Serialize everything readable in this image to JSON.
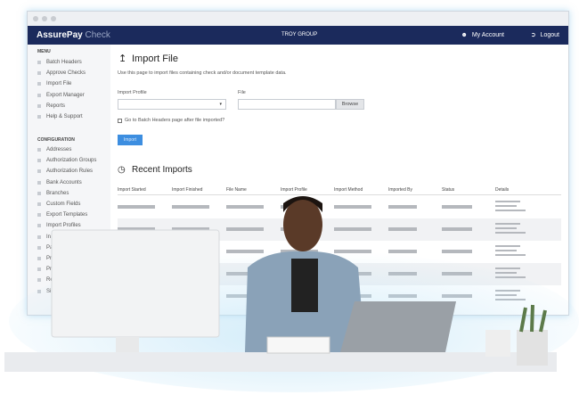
{
  "header": {
    "brand_bold": "AssurePay",
    "brand_light": " Check",
    "organization": "TROY GROUP",
    "my_account": "My Account",
    "logout": "Logout"
  },
  "sidebar": {
    "menu_heading": "MENU",
    "menu": [
      "Batch Headers",
      "Approve Checks",
      "Import File",
      "Export Manager",
      "Reports",
      "Help & Support"
    ],
    "config_heading": "CONFIGURATION",
    "config": [
      "Addresses",
      "Authorization Groups",
      "Authorization Rules",
      "Bank Accounts",
      "Branches",
      "Custom Fields",
      "Export Templates",
      "Import Profiles",
      "In",
      "Pay",
      "Print",
      "Printe",
      "Resou",
      "Signatu"
    ]
  },
  "main": {
    "title": "Import File",
    "description": "Use this page to import files containing check and/or document template data.",
    "import_profile_label": "Import Profile",
    "import_profile_value": "",
    "file_label": "File",
    "file_value": "",
    "browse": "Browse",
    "checkbox_label": "Go to Batch Headers page after file imported?",
    "checkbox_checked": false,
    "import_button": "Import",
    "recent_title": "Recent Imports",
    "columns": [
      "Import Started",
      "Import Finished",
      "File Name",
      "Import Profile",
      "Import Method",
      "Imported By",
      "Status",
      "Details"
    ]
  },
  "colors": {
    "nav": "#1b2a5c",
    "accent": "#3d8ee0"
  }
}
